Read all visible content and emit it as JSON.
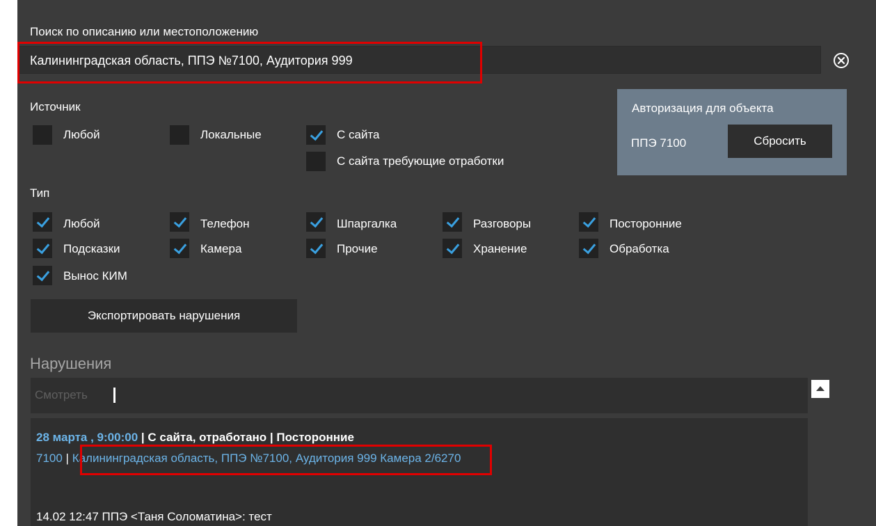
{
  "search": {
    "label": "Поиск по описанию или местоположению",
    "value": "Калининградская область, ППЭ №7100, Аудитория 999"
  },
  "source": {
    "heading": "Источник",
    "options": [
      {
        "label": "Любой",
        "checked": false
      },
      {
        "label": "Локальные",
        "checked": false
      },
      {
        "label": "С сайта",
        "checked": true
      },
      {
        "label": "С сайта требующие отработки",
        "checked": false
      }
    ]
  },
  "auth": {
    "title": "Авторизация для объекта",
    "object": "ППЭ 7100",
    "reset_label": "Сбросить"
  },
  "type": {
    "heading": "Тип",
    "options": [
      {
        "label": "Любой",
        "checked": true
      },
      {
        "label": "Телефон",
        "checked": true
      },
      {
        "label": "Шпаргалка",
        "checked": true
      },
      {
        "label": "Разговоры",
        "checked": true
      },
      {
        "label": "Посторонние",
        "checked": true
      },
      {
        "label": "Подсказки",
        "checked": true
      },
      {
        "label": "Камера",
        "checked": true
      },
      {
        "label": "Прочие",
        "checked": true
      },
      {
        "label": "Хранение",
        "checked": true
      },
      {
        "label": "Обработка",
        "checked": true
      },
      {
        "label": "Вынос КИМ",
        "checked": true
      }
    ]
  },
  "export_label": "Экспортировать нарушения",
  "violations": {
    "title": "Нарушения",
    "filter_placeholder": "Смотреть",
    "record": {
      "date": "28 марта , 9:00:00",
      "status": " | С сайта, отработано | Посторонние",
      "ppe": "7100",
      "separator": " | ",
      "location": "Калининградская область, ППЭ №7100, Аудитория 999",
      "camera": "Камера 2/6270",
      "comment": "14.02 12:47 ППЭ <Таня Соломатина>: тест"
    }
  },
  "colors": {
    "panel_bg": "#3b3b3b",
    "auth_bg": "#6d7d8c",
    "check_accent": "#3aa0e0",
    "link": "#6cb4e8",
    "highlight": "#e00000"
  },
  "icons": {
    "clear": "close-circle-icon",
    "check": "checkmark-icon",
    "scroll_up": "triangle-up-icon"
  }
}
